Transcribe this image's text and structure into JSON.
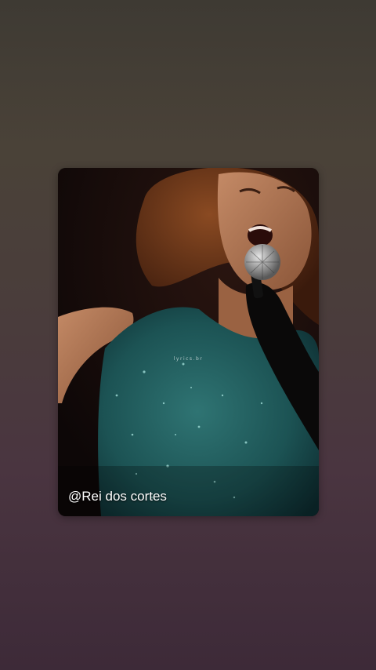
{
  "story": {
    "mention": "@Rei dos cortes",
    "watermark": "lyrics.br",
    "image_subject": "singer-performing-with-microphone"
  },
  "colors": {
    "background_top": "#3e3a33",
    "background_bottom": "#3d2a38",
    "dress_teal": "#1f5a5a",
    "mention_text": "#ffffff"
  }
}
